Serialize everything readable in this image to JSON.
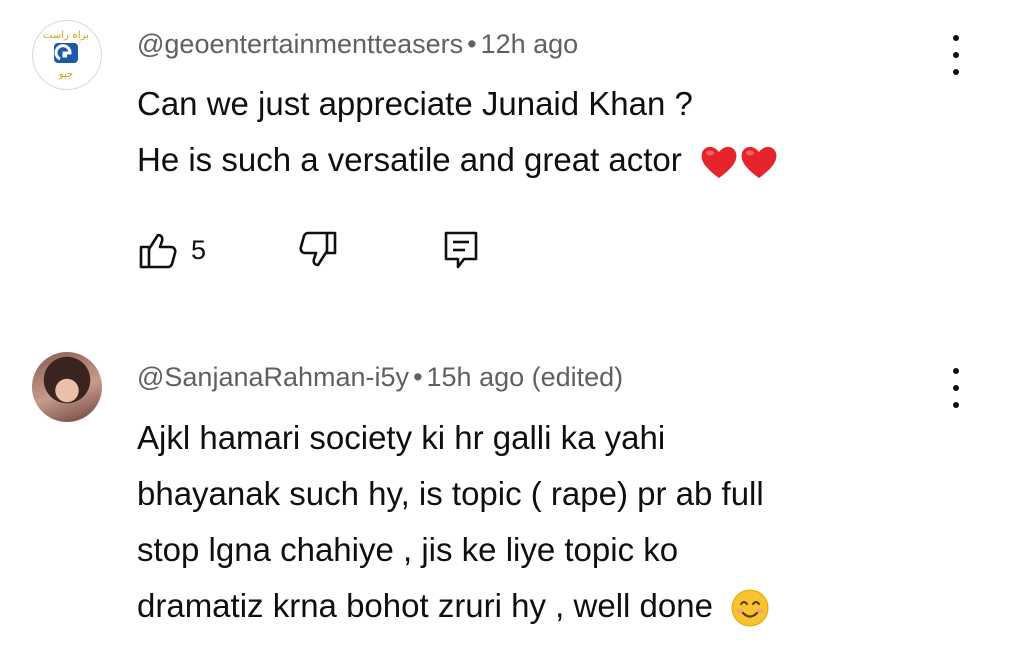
{
  "comments": [
    {
      "handle": "@geoentertainmentteasers",
      "separator": "•",
      "time": "12h ago",
      "lines": [
        "Can we just appreciate Junaid Khan ?",
        "He is such a versatile and great actor"
      ],
      "emojis": [
        "red-heart",
        "red-heart"
      ],
      "like_count": "5",
      "avatar_logo_text": "براہ راست جیو"
    },
    {
      "handle": "@SanjanaRahman-i5y",
      "separator": "•",
      "time": "15h ago (edited)",
      "lines": [
        "Ajkl hamari society ki hr galli ka yahi",
        "bhayanak such hy, is topic ( rape) pr ab full",
        "stop lgna chahiye , jis ke liye topic ko",
        "dramatiz krna bohot zruri hy , well done"
      ],
      "emojis": [
        "smiling-face"
      ]
    }
  ],
  "colors": {
    "text": "#0f0f0f",
    "meta": "#606060",
    "heart": "#e5242c",
    "geo_blue": "#1a5aa8",
    "geo_gold": "#d4a017"
  },
  "icons": [
    "thumbs-up-icon",
    "thumbs-down-icon",
    "reply-icon",
    "more-vert-icon"
  ]
}
